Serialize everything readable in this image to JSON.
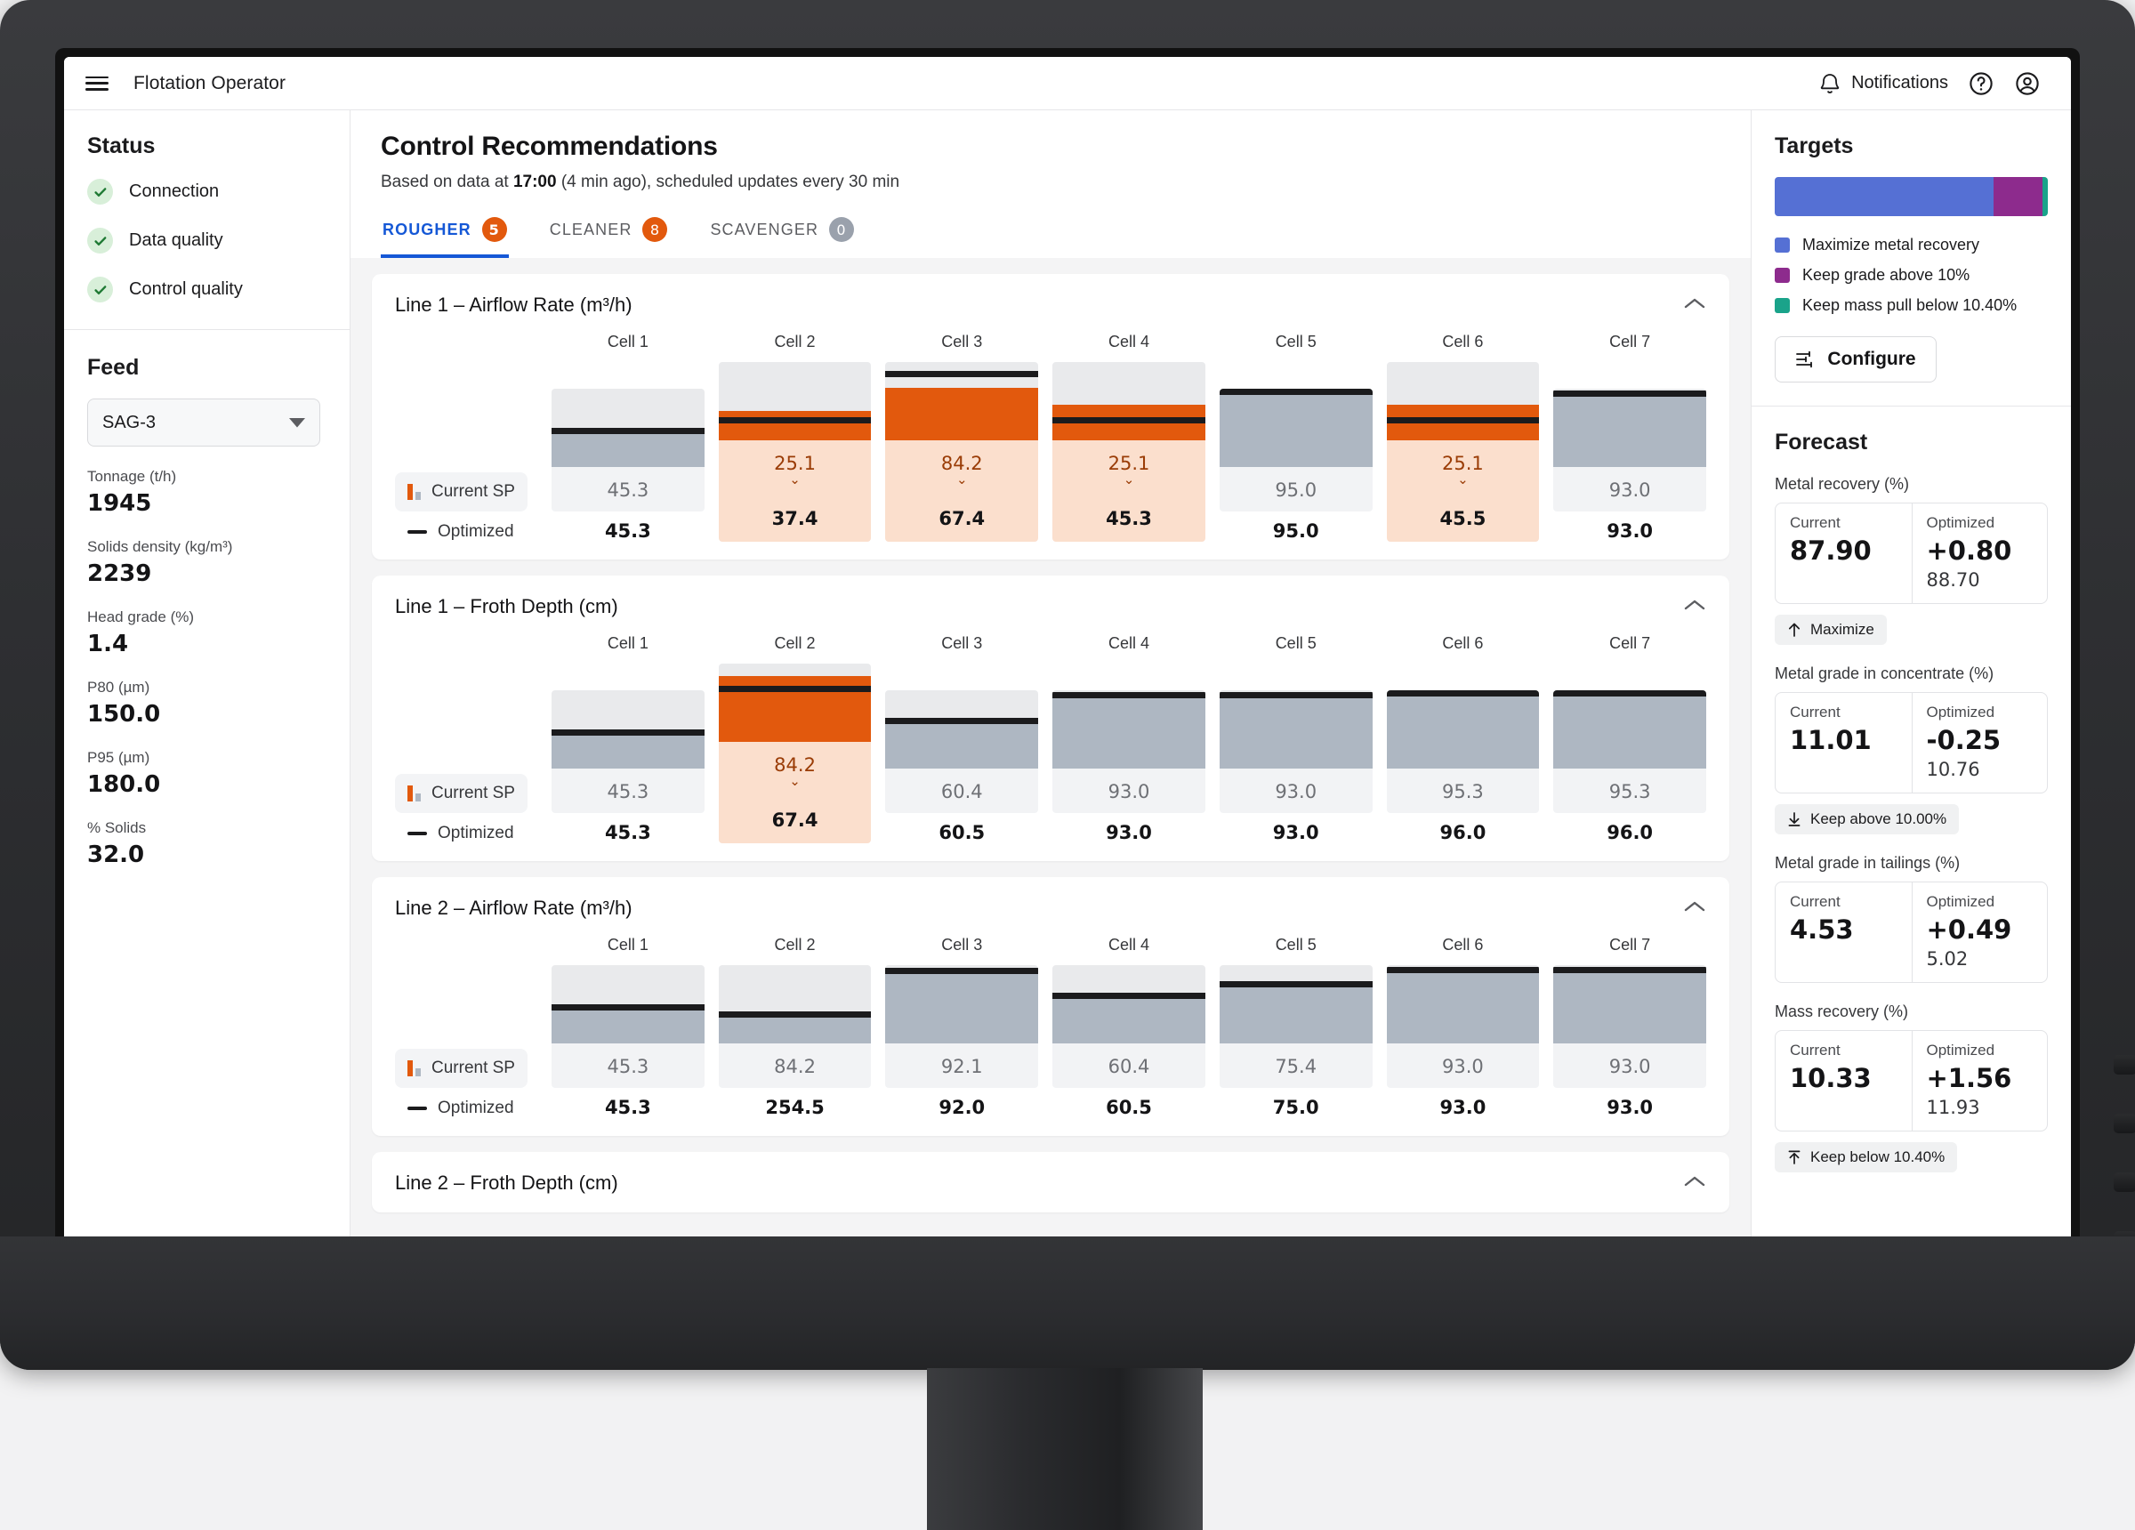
{
  "topbar": {
    "menu_icon": "hamburger-icon",
    "title": "Flotation Operator",
    "notifications_label": "Notifications",
    "bell_icon": "bell-icon",
    "help_icon": "help-circle-icon",
    "account_icon": "account-circle-icon"
  },
  "sidebar": {
    "status_title": "Status",
    "status_items": [
      {
        "label": "Connection",
        "state": "ok"
      },
      {
        "label": "Data quality",
        "state": "ok"
      },
      {
        "label": "Control quality",
        "state": "ok"
      }
    ],
    "feed_title": "Feed",
    "feed_select_value": "SAG-3",
    "metrics": [
      {
        "label": "Tonnage (t/h)",
        "value": "1945"
      },
      {
        "label": "Solids density (kg/m³)",
        "value": "2239"
      },
      {
        "label": "Head grade (%)",
        "value": "1.4"
      },
      {
        "label": "P80 (µm)",
        "value": "150.0"
      },
      {
        "label": "P95 (µm)",
        "value": "180.0"
      },
      {
        "label": "% Solids",
        "value": "32.0"
      }
    ]
  },
  "main": {
    "page_title": "Control Recommendations",
    "subtitle_pre": "Based on data at ",
    "subtitle_time": "17:00",
    "subtitle_post": " (4 min ago), scheduled updates every 30 min",
    "tabs": [
      {
        "label": "ROUGHER",
        "count": "5",
        "active": true,
        "pill": "orange"
      },
      {
        "label": "CLEANER",
        "count": "8",
        "active": false,
        "pill": "orange"
      },
      {
        "label": "SCAVENGER",
        "count": "0",
        "active": false,
        "pill": "grey"
      }
    ],
    "legend": {
      "current_sp": "Current SP",
      "optimized": "Optimized"
    },
    "collapse_icon": "chevron-up-icon"
  },
  "chart_data": [
    {
      "type": "bar",
      "title": "Line 1 – Airflow Rate (m³/h)",
      "categories": [
        "Cell 1",
        "Cell 2",
        "Cell 3",
        "Cell 4",
        "Cell 5",
        "Cell 6",
        "Cell 7"
      ],
      "series": [
        {
          "name": "Current SP",
          "values": [
            45.3,
            25.1,
            84.2,
            25.1,
            95.0,
            25.1,
            93.0
          ]
        },
        {
          "name": "Optimized",
          "values": [
            45.3,
            37.4,
            67.4,
            45.3,
            95.0,
            45.5,
            93.0
          ]
        }
      ],
      "current_display": [
        "45.3",
        "25.1",
        "84.2",
        "25.1",
        "95.0",
        "25.1",
        "93.0"
      ],
      "optimized_display": [
        "45.3",
        "37.4",
        "67.4",
        "45.3",
        "95.0",
        "45.5",
        "93.0"
      ],
      "changed": [
        false,
        true,
        true,
        true,
        false,
        true,
        false
      ],
      "ylim": [
        0,
        100
      ],
      "bar_fill_pct": [
        45.3,
        37.4,
        67.4,
        45.3,
        95.0,
        45.5,
        93.0
      ],
      "sp_line_pct": [
        45.3,
        25.1,
        84.2,
        25.1,
        95.0,
        25.1,
        93.0
      ]
    },
    {
      "type": "bar",
      "title": "Line 1 – Froth Depth (cm)",
      "categories": [
        "Cell 1",
        "Cell 2",
        "Cell 3",
        "Cell 4",
        "Cell 5",
        "Cell 6",
        "Cell 7"
      ],
      "series": [
        {
          "name": "Current SP",
          "values": [
            45.3,
            84.2,
            60.4,
            93.0,
            93.0,
            95.3,
            95.3
          ]
        },
        {
          "name": "Optimized",
          "values": [
            45.3,
            67.4,
            60.5,
            93.0,
            93.0,
            96.0,
            96.0
          ]
        }
      ],
      "current_display": [
        "45.3",
        "84.2",
        "60.4",
        "93.0",
        "93.0",
        "95.3",
        "95.3"
      ],
      "optimized_display": [
        "45.3",
        "67.4",
        "60.5",
        "93.0",
        "93.0",
        "96.0",
        "96.0"
      ],
      "changed": [
        false,
        true,
        false,
        false,
        false,
        false,
        false
      ],
      "ylim": [
        0,
        100
      ],
      "bar_fill_pct": [
        45.3,
        84.2,
        60.5,
        93.0,
        93.0,
        96.0,
        96.0
      ],
      "sp_line_pct": [
        45.3,
        67.4,
        60.4,
        93.0,
        93.0,
        95.3,
        95.3
      ]
    },
    {
      "type": "bar",
      "title": "Line 2 – Airflow Rate (m³/h)",
      "categories": [
        "Cell 1",
        "Cell 2",
        "Cell 3",
        "Cell 4",
        "Cell 5",
        "Cell 6",
        "Cell 7"
      ],
      "series": [
        {
          "name": "Current SP",
          "values": [
            45.3,
            84.2,
            92.1,
            60.4,
            75.4,
            93.0,
            93.0
          ]
        },
        {
          "name": "Optimized",
          "values": [
            45.3,
            254.5,
            92.0,
            60.5,
            75.0,
            93.0,
            93.0
          ]
        }
      ],
      "current_display": [
        "45.3",
        "84.2",
        "92.1",
        "60.4",
        "75.4",
        "93.0",
        "93.0"
      ],
      "optimized_display": [
        "45.3",
        "254.5",
        "92.0",
        "60.5",
        "75.0",
        "93.0",
        "93.0"
      ],
      "changed": [
        false,
        false,
        false,
        false,
        false,
        false,
        false
      ],
      "ylim": [
        0,
        100
      ],
      "bar_fill_pct": [
        45.3,
        36.0,
        92.0,
        60.5,
        75.0,
        93.0,
        93.0
      ],
      "sp_line_pct": [
        45.3,
        36.0,
        92.1,
        60.4,
        75.4,
        93.0,
        93.0
      ]
    },
    {
      "type": "bar",
      "title": "Line 2 – Froth Depth (cm)",
      "categories": [],
      "series": [],
      "current_display": [],
      "optimized_display": [],
      "changed": [],
      "collapsed_view": true
    }
  ],
  "targets": {
    "title": "Targets",
    "bar_segments": [
      {
        "label": "Maximize metal recovery",
        "color": "#5570d4",
        "pct": 80
      },
      {
        "label": "Keep grade above 10%",
        "color": "#8d2b8d",
        "pct": 18
      },
      {
        "label": "Keep mass pull below 10.40%",
        "color": "#1aa38a",
        "pct": 2
      }
    ],
    "configure_label": "Configure",
    "configure_icon": "sliders-icon"
  },
  "forecast": {
    "title": "Forecast",
    "current_label": "Current",
    "optimized_label": "Optimized",
    "blocks": [
      {
        "label": "Metal recovery (%)",
        "current": "87.90",
        "delta": "+0.80",
        "optimized": "88.70",
        "chip": "Maximize",
        "chip_icon": "arrow-up-icon"
      },
      {
        "label": "Metal grade in concentrate (%)",
        "current": "11.01",
        "delta": "-0.25",
        "optimized": "10.76",
        "chip": "Keep above 10.00%",
        "chip_icon": "floor-limit-icon"
      },
      {
        "label": "Metal grade in tailings (%)",
        "current": "4.53",
        "delta": "+0.49",
        "optimized": "5.02",
        "chip": null,
        "chip_icon": null
      },
      {
        "label": "Mass recovery (%)",
        "current": "10.33",
        "delta": "+1.56",
        "optimized": "11.93",
        "chip": "Keep below 10.40%",
        "chip_icon": "ceiling-limit-icon"
      }
    ]
  }
}
